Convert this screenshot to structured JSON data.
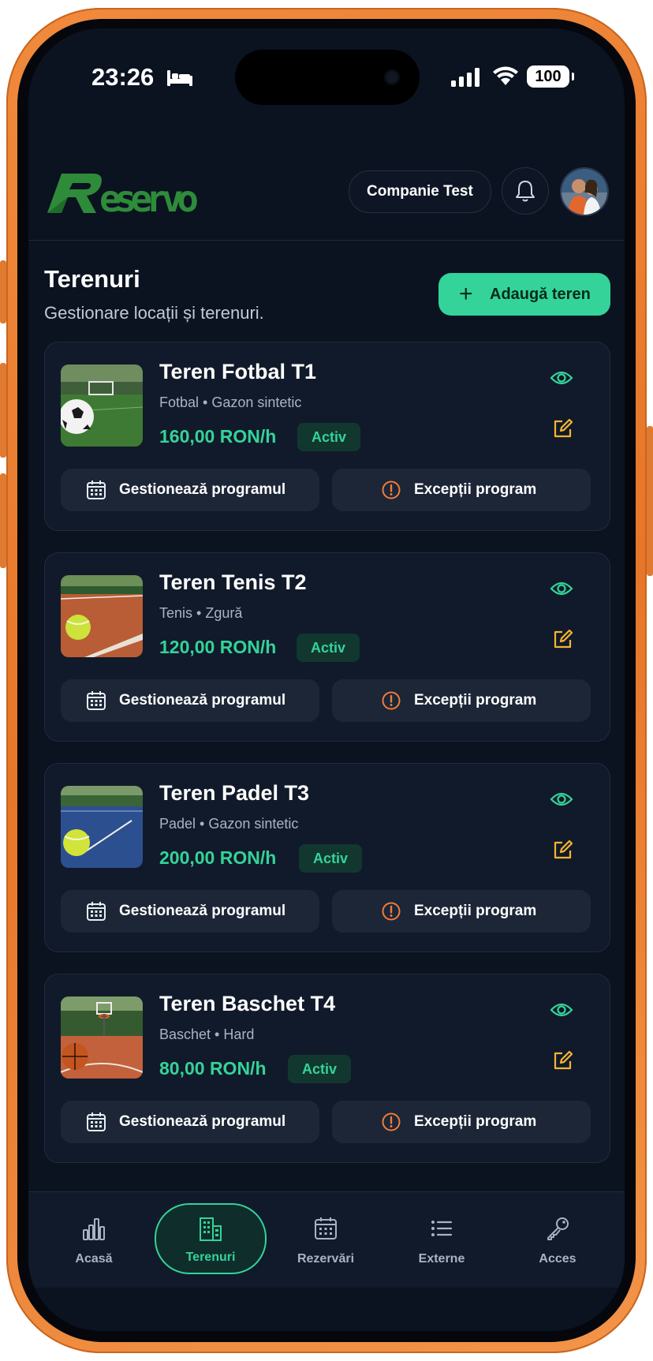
{
  "status_bar": {
    "time": "23:26",
    "battery": "100"
  },
  "header": {
    "logo_text": "Reservo",
    "company": "Companie Test"
  },
  "page": {
    "title": "Terenuri",
    "subtitle": "Gestionare locații și terenuri.",
    "add_button": "Adaugă teren"
  },
  "colors": {
    "accent": "#34d399",
    "edit": "#f5b431",
    "warning": "#f07c3a",
    "background": "#0b1220",
    "card": "#111a2a"
  },
  "courts": [
    {
      "name": "Teren Fotbal T1",
      "meta": "Fotbal • Gazon sintetic",
      "price": "160,00 RON/h",
      "status": "Activ",
      "image": "soccer-field-photo",
      "schedule_btn": "Gestionează programul",
      "exceptions_btn": "Excepții program"
    },
    {
      "name": "Teren Tenis T2",
      "meta": "Tenis • Zgură",
      "price": "120,00 RON/h",
      "status": "Activ",
      "image": "clay-tennis-court-photo",
      "schedule_btn": "Gestionează programul",
      "exceptions_btn": "Excepții program"
    },
    {
      "name": "Teren Padel T3",
      "meta": "Padel • Gazon sintetic",
      "price": "200,00 RON/h",
      "status": "Activ",
      "image": "padel-court-photo",
      "schedule_btn": "Gestionează programul",
      "exceptions_btn": "Excepții program"
    },
    {
      "name": "Teren Baschet T4",
      "meta": "Baschet • Hard",
      "price": "80,00 RON/h",
      "status": "Activ",
      "image": "basketball-court-photo",
      "schedule_btn": "Gestionează programul",
      "exceptions_btn": "Excepții program"
    }
  ],
  "tabbar": [
    {
      "label": "Acasă",
      "icon": "bar-chart-icon"
    },
    {
      "label": "Terenuri",
      "icon": "building-icon",
      "active": true
    },
    {
      "label": "Rezervări",
      "icon": "calendar-icon"
    },
    {
      "label": "Externe",
      "icon": "list-icon"
    },
    {
      "label": "Acces",
      "icon": "key-icon"
    }
  ]
}
